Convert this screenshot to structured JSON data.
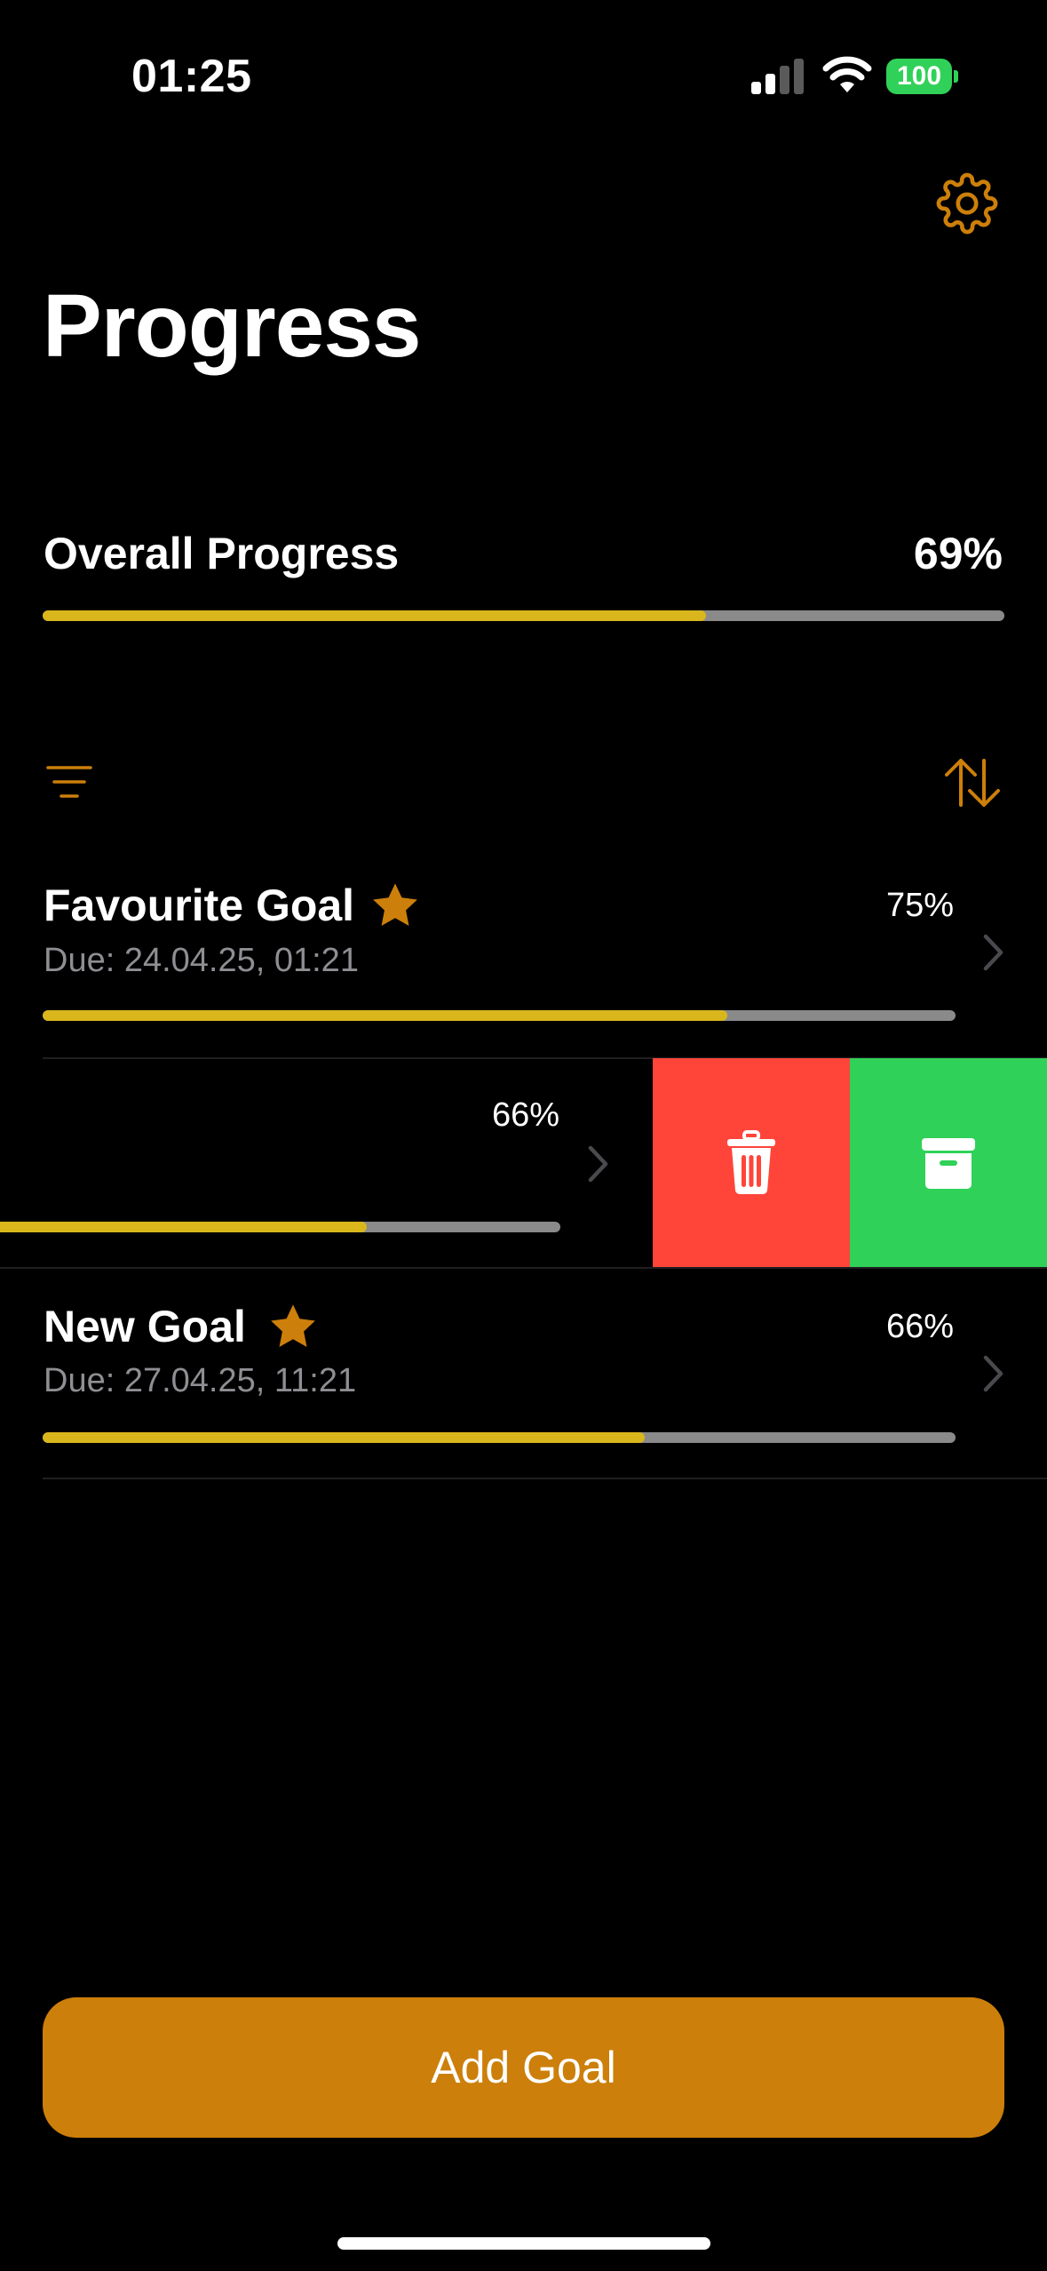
{
  "colors": {
    "background": "#000000",
    "accent": "#CC7F0A",
    "progress_fill": "#D9B71C",
    "progress_track": "#8A8A8A",
    "delete": "#FF453A",
    "archive": "#30D158",
    "battery": "#30D158"
  },
  "status_bar": {
    "time": "01:25",
    "battery_level": "100",
    "signal_icon": "cellular-signal-icon",
    "wifi_icon": "wifi-icon"
  },
  "header": {
    "title": "Progress",
    "settings_icon": "gear-icon"
  },
  "overall": {
    "label": "Overall Progress",
    "value_text": "69%",
    "progress": 0.69
  },
  "toolbar": {
    "filter_icon": "filter-icon",
    "sort_icon": "sort-arrows-icon"
  },
  "goals": [
    {
      "title": "Favourite Goal",
      "favourite": true,
      "due": "Due: 24.04.25, 01:21",
      "percent_text": "75%",
      "progress": 0.75
    },
    {
      "title": "",
      "favourite": false,
      "due": "",
      "percent_text": "66%",
      "progress": 0.66,
      "swiped": true
    },
    {
      "title": "New Goal",
      "favourite": true,
      "due": "Due: 27.04.25, 11:21",
      "percent_text": "66%",
      "progress": 0.66
    }
  ],
  "swipe_actions": {
    "delete_icon": "trash-icon",
    "archive_icon": "archive-box-icon"
  },
  "add_button": {
    "label": "Add Goal"
  }
}
